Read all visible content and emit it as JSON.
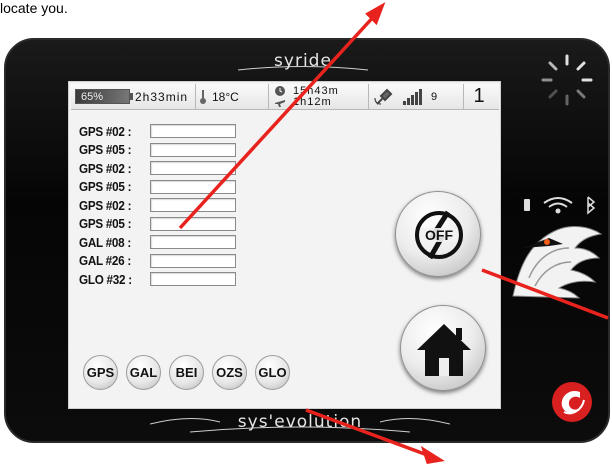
{
  "caption": "locate you.",
  "device": {
    "brand_top": "syride",
    "brand_bottom": "sys'evolution"
  },
  "status_bar": {
    "battery": "65%",
    "battery_time": "2h33min",
    "temperature": "18°C",
    "flight_time": "15h43m",
    "airborne_time": "1h12m",
    "satellites": "9",
    "page_number": "1"
  },
  "gps_rows": [
    {
      "label": "GPS #02 :"
    },
    {
      "label": "GPS #05 :"
    },
    {
      "label": "GPS #02 :"
    },
    {
      "label": "GPS #05 :"
    },
    {
      "label": "GPS #02 :"
    },
    {
      "label": "GPS #05 :"
    },
    {
      "label": "GAL #08 :"
    },
    {
      "label": "GAL #26 :"
    },
    {
      "label": "GLO #32 :"
    }
  ],
  "filters": [
    "GPS",
    "GAL",
    "BEI",
    "OZS",
    "GLO"
  ],
  "buttons": {
    "off_label": "OFF"
  },
  "colors": {
    "arrow": "#e8231e",
    "screen_bg": "#f3f3f3",
    "device_body": "#0c0c0c",
    "logo_red": "#d92020"
  }
}
